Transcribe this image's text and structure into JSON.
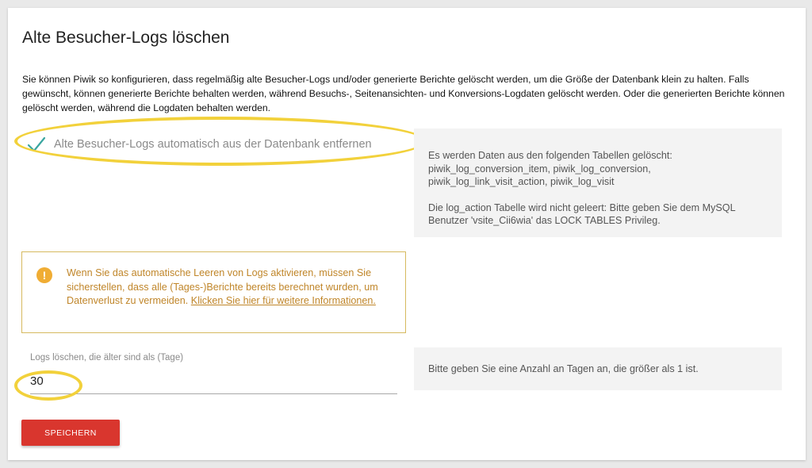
{
  "title": "Alte Besucher-Logs löschen",
  "intro": "Sie können Piwik so konfigurieren, dass regelmäßig alte Besucher-Logs und/oder generierte Berichte gelöscht werden, um die Größe der Datenbank klein zu halten. Falls gewünscht, können generierte Berichte behalten werden, während Besuchs-, Seitenansichten- und Konversions-Logdaten gelöscht werden. Oder die generierten Berichte können gelöscht werden, während die Logdaten behalten werden.",
  "checkbox": {
    "label": "Alte Besucher-Logs automatisch aus der Datenbank entfernen",
    "checked": true
  },
  "tables_info": {
    "line1": "Es werden Daten aus den folgenden Tabellen gelöscht:",
    "line2": "piwik_log_conversion_item, piwik_log_conversion,",
    "line3": "piwik_log_link_visit_action, piwik_log_visit",
    "line4": "Die log_action Tabelle wird nicht geleert: Bitte geben Sie dem MySQL",
    "line5": "Benutzer 'vsite_Cii6wia' das LOCK TABLES Privileg."
  },
  "warning": {
    "icon": "exclamation-icon",
    "text": "Wenn Sie das automatische Leeren von Logs aktivieren, müssen Sie sicherstellen, dass alle (Tages-)Berichte bereits berechnet wurden, um Datenverlust zu vermeiden. ",
    "link": "Klicken Sie hier für weitere Informationen."
  },
  "days_field": {
    "label": "Logs löschen, die älter sind als (Tage)",
    "value": "30"
  },
  "days_help": "Bitte geben Sie eine Anzahl an Tagen an, die größer als 1 ist.",
  "save_label": "SPEICHERN",
  "colors": {
    "accent": "#d9362e",
    "warning": "#c0862a",
    "highlight": "#f2d13b",
    "check": "#3aa6a0"
  }
}
